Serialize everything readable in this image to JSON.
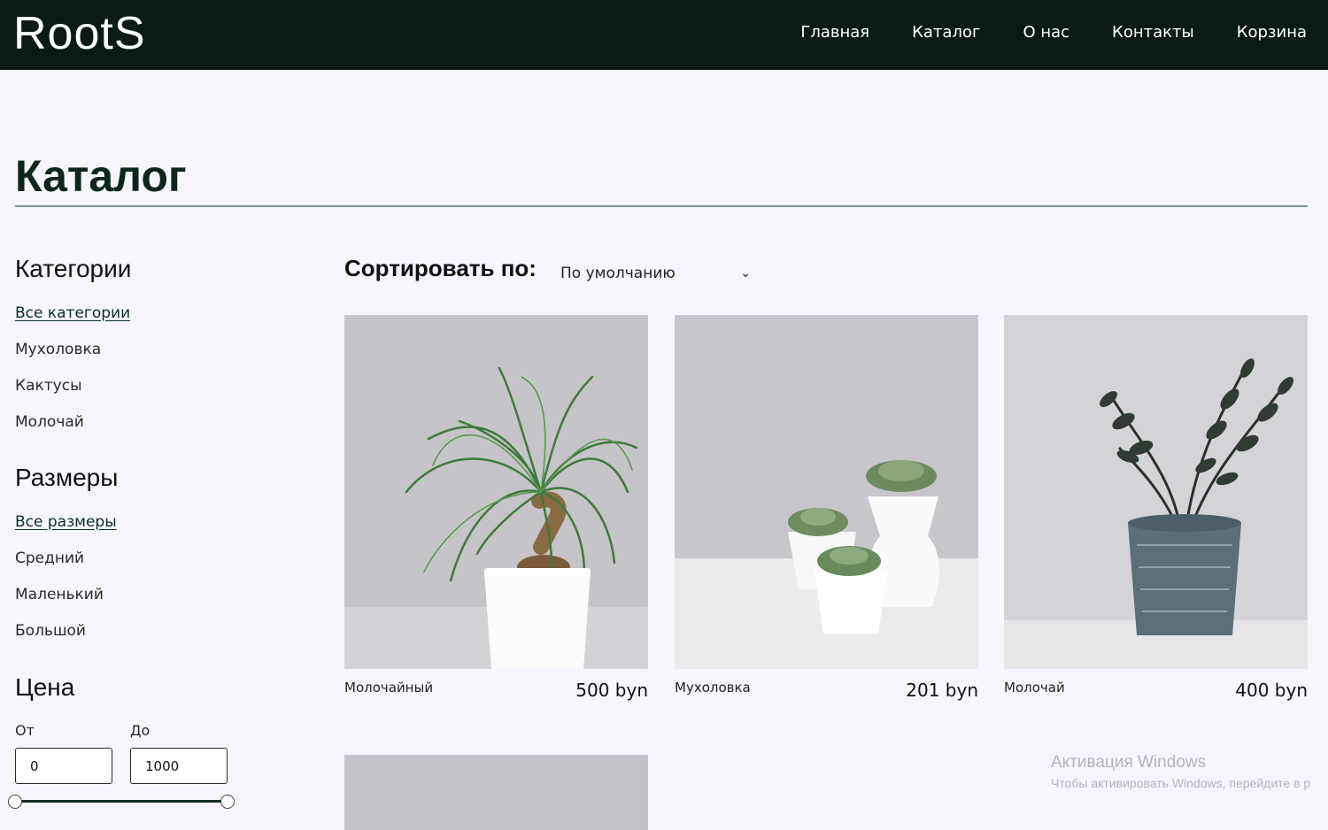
{
  "header": {
    "logo": "RootS",
    "nav": [
      "Главная",
      "Каталог",
      "О нас",
      "Контакты",
      "Корзина"
    ]
  },
  "page_title": "Каталог",
  "sidebar": {
    "categories_title": "Категории",
    "categories": [
      "Все категории",
      "Мухоловка",
      "Кактусы",
      "Молочай"
    ],
    "sizes_title": "Размеры",
    "sizes": [
      "Все размеры",
      "Средний",
      "Маленький",
      "Большой"
    ],
    "price_title": "Цена",
    "price_from_label": "От",
    "price_to_label": "До",
    "price_from_value": "0",
    "price_to_value": "1000",
    "range": {
      "min": 0,
      "max": 1000
    }
  },
  "sort": {
    "label": "Сортировать по:",
    "selected": "По умолчанию"
  },
  "products": [
    {
      "name": "Молочайный",
      "price": "500 byn"
    },
    {
      "name": "Мухоловка",
      "price": "201 byn"
    },
    {
      "name": "Молочай",
      "price": "400 byn"
    }
  ],
  "watermark": {
    "line1": "Активация Windows",
    "line2": "Чтобы активировать Windows, перейдите в р"
  },
  "colors": {
    "header_bg": "#0b1a15",
    "page_bg": "#f7f5fd",
    "accent": "#0b2e22"
  },
  "icons": [
    "chevron-down-icon"
  ]
}
